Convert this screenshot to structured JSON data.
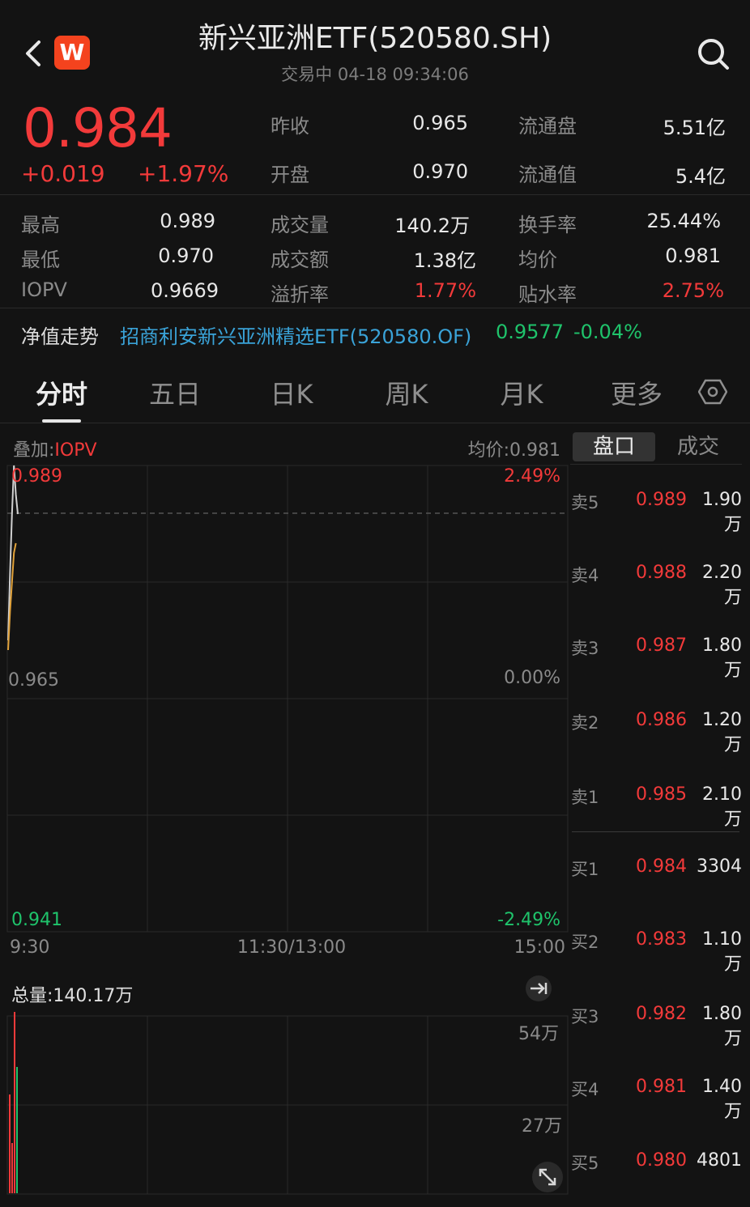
{
  "header": {
    "title": "新兴亚洲ETF(520580.SH)",
    "status": "交易中  04-18 09:34:06",
    "logo_letter": "W"
  },
  "quote": {
    "price": "0.984",
    "change": "+0.019",
    "change_pct": "+1.97%",
    "prev_close_label": "昨收",
    "prev_close": "0.965",
    "open_label": "开盘",
    "open": "0.970",
    "float_shares_label": "流通盘",
    "float_shares": "5.51亿",
    "float_value_label": "流通值",
    "float_value": "5.4亿",
    "high_label": "最高",
    "high": "0.989",
    "low_label": "最低",
    "low": "0.970",
    "iopv_label": "IOPV",
    "iopv": "0.9669",
    "volume_label": "成交量",
    "volume": "140.2万",
    "amount_label": "成交额",
    "amount": "1.38亿",
    "premium_label": "溢折率",
    "premium": "1.77%",
    "turnover_label": "换手率",
    "turnover": "25.44%",
    "avg_label": "均价",
    "avg": "0.981",
    "discount_label": "贴水率",
    "discount": "2.75%"
  },
  "nav": {
    "label": "净值走势",
    "fund": "招商利安新兴亚洲精选ETF(520580.OF)",
    "value": "0.9577",
    "change": "-0.04%"
  },
  "tabs": [
    "分时",
    "五日",
    "日K",
    "周K",
    "月K",
    "更多"
  ],
  "active_tab": "分时",
  "chart": {
    "overlay_prefix": "叠加:",
    "overlay_value": "IOPV",
    "avg_price": "均价:0.981",
    "y_top": "0.989",
    "y_mid": "0.965",
    "y_bot": "0.941",
    "pct_top": "2.49%",
    "pct_mid": "0.00%",
    "pct_bot": "-2.49%",
    "x_start": "9:30",
    "x_mid": "11:30/13:00",
    "x_end": "15:00",
    "total_volume": "总量:140.17万",
    "vol_top": "54万",
    "vol_mid": "27万"
  },
  "chart_data": {
    "type": "line",
    "x_range": [
      "9:30",
      "15:00"
    ],
    "ylim": [
      0.941,
      0.989
    ],
    "reference": 0.965,
    "series": [
      {
        "values": [
          0.971,
          0.978,
          0.984,
          0.989,
          0.986,
          0.984
        ],
        "color": "#d0d0d0"
      },
      {
        "values": [
          0.97,
          0.974,
          0.977,
          0.98,
          0.981
        ],
        "color": "#e2a33b"
      }
    ]
  },
  "orderbook": {
    "tabs": [
      "盘口",
      "成交"
    ],
    "asks": [
      {
        "label": "卖5",
        "price": "0.989",
        "vol": "1.90万"
      },
      {
        "label": "卖4",
        "price": "0.988",
        "vol": "2.20万"
      },
      {
        "label": "卖3",
        "price": "0.987",
        "vol": "1.80万"
      },
      {
        "label": "卖2",
        "price": "0.986",
        "vol": "1.20万"
      },
      {
        "label": "卖1",
        "price": "0.985",
        "vol": "2.10万"
      }
    ],
    "bids": [
      {
        "label": "买1",
        "price": "0.984",
        "vol": "3304"
      },
      {
        "label": "买2",
        "price": "0.983",
        "vol": "1.10万"
      },
      {
        "label": "买3",
        "price": "0.982",
        "vol": "1.80万"
      },
      {
        "label": "买4",
        "price": "0.981",
        "vol": "1.40万"
      },
      {
        "label": "买5",
        "price": "0.980",
        "vol": "4801"
      }
    ]
  },
  "colors": {
    "up": "#f23a3a",
    "down": "#1fc36b",
    "fund_link": "#3aa3d8",
    "avg_line": "#e2a33b"
  }
}
